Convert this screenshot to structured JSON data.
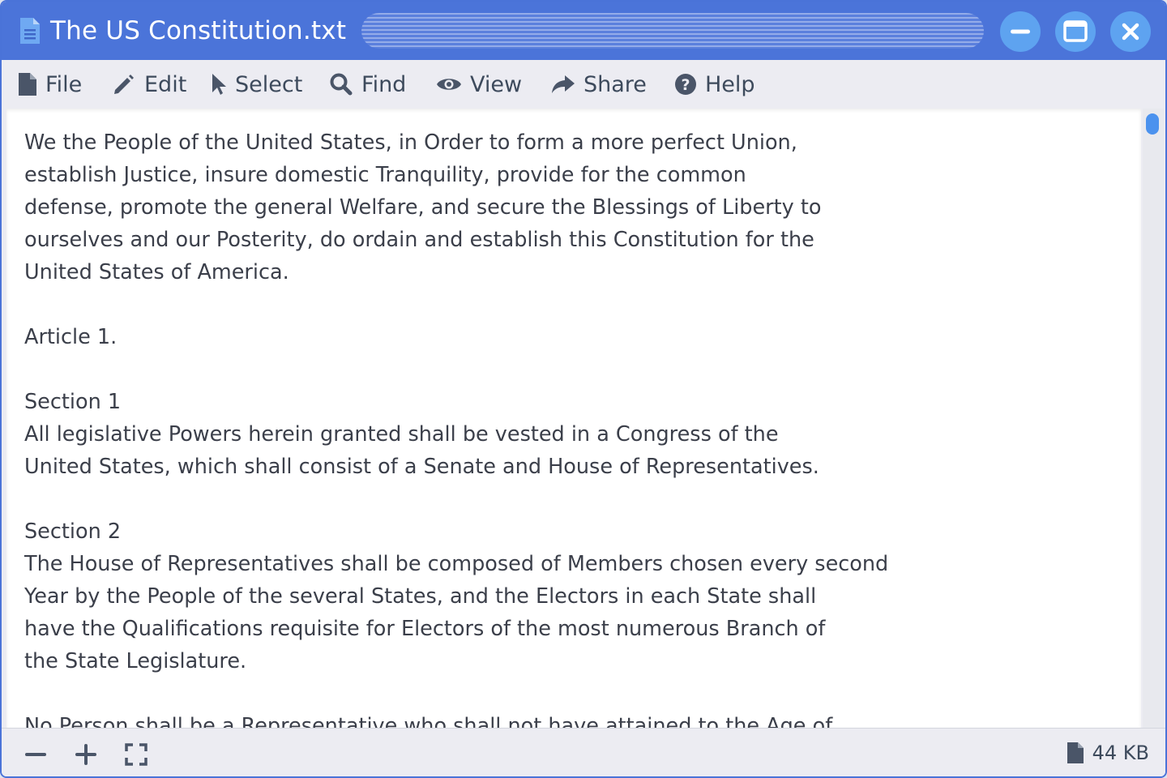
{
  "window": {
    "title": "The US Constitution.txt",
    "file_icon": "document-icon"
  },
  "menu": {
    "items": [
      {
        "label": "File",
        "icon": "file-icon"
      },
      {
        "label": "Edit",
        "icon": "pencil-icon"
      },
      {
        "label": "Select",
        "icon": "cursor-icon"
      },
      {
        "label": "Find",
        "icon": "search-icon"
      },
      {
        "label": "View",
        "icon": "eye-icon"
      },
      {
        "label": "Share",
        "icon": "share-icon"
      },
      {
        "label": "Help",
        "icon": "help-icon"
      }
    ]
  },
  "document": {
    "text": "We the People of the United States, in Order to form a more perfect Union,\nestablish Justice, insure domestic Tranquility, provide for the common\ndefense, promote the general Welfare, and secure the Blessings of Liberty to\nourselves and our Posterity, do ordain and establish this Constitution for the\nUnited States of America.\n\nArticle 1.\n\nSection 1\nAll legislative Powers herein granted shall be vested in a Congress of the\nUnited States, which shall consist of a Senate and House of Representatives.\n\nSection 2\nThe House of Representatives shall be composed of Members chosen every second\nYear by the People of the several States, and the Electors in each State shall\nhave the Qualifications requisite for Electors of the most numerous Branch of\nthe State Legislature.\n\nNo Person shall be a Representative who shall not have attained to the Age of"
  },
  "status": {
    "file_size": "44 KB"
  },
  "colors": {
    "accent": "#4b74d9",
    "button": "#5ea3f0",
    "scroll_thumb": "#4b92ee",
    "text": "#3b3f4a"
  }
}
